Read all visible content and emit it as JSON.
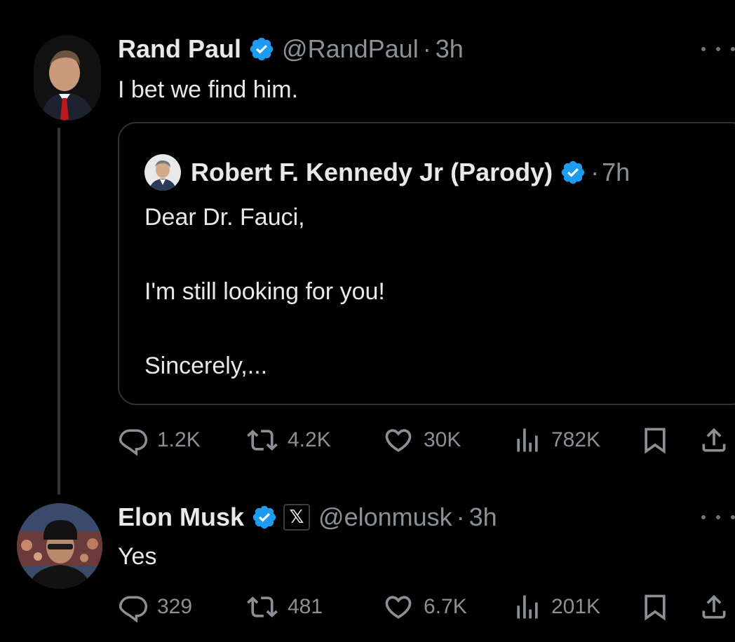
{
  "thread": [
    {
      "author": {
        "name": "Rand Paul",
        "handle": "@RandPaul",
        "verified_badge_icon": "verified-check-icon"
      },
      "separator": "·",
      "time": "3h",
      "text": "I bet we find him.",
      "quoted_post": {
        "author": {
          "name": "Robert F. Kennedy Jr (Parody)",
          "verified_badge_icon": "verified-check-icon"
        },
        "separator": "·",
        "time": "7h",
        "lines": [
          "Dear Dr. Fauci,",
          "I'm still looking for you!",
          "Sincerely,..."
        ]
      },
      "metrics": {
        "replies": "1.2K",
        "reposts": "4.2K",
        "likes": "30K",
        "views": "782K"
      }
    },
    {
      "author": {
        "name": "Elon Musk",
        "handle": "@elonmusk",
        "verified_badge_icon": "verified-check-icon",
        "affiliation_badge": "𝕏"
      },
      "separator": "·",
      "time": "3h",
      "text": "Yes",
      "metrics": {
        "replies": "329",
        "reposts": "481",
        "likes": "6.7K",
        "views": "201K"
      }
    }
  ],
  "colors": {
    "background": "#000000",
    "primary_text": "#e7e9ea",
    "secondary_text": "#8b9096",
    "verified_blue": "#1d9bf0",
    "border": "#2f3336"
  }
}
